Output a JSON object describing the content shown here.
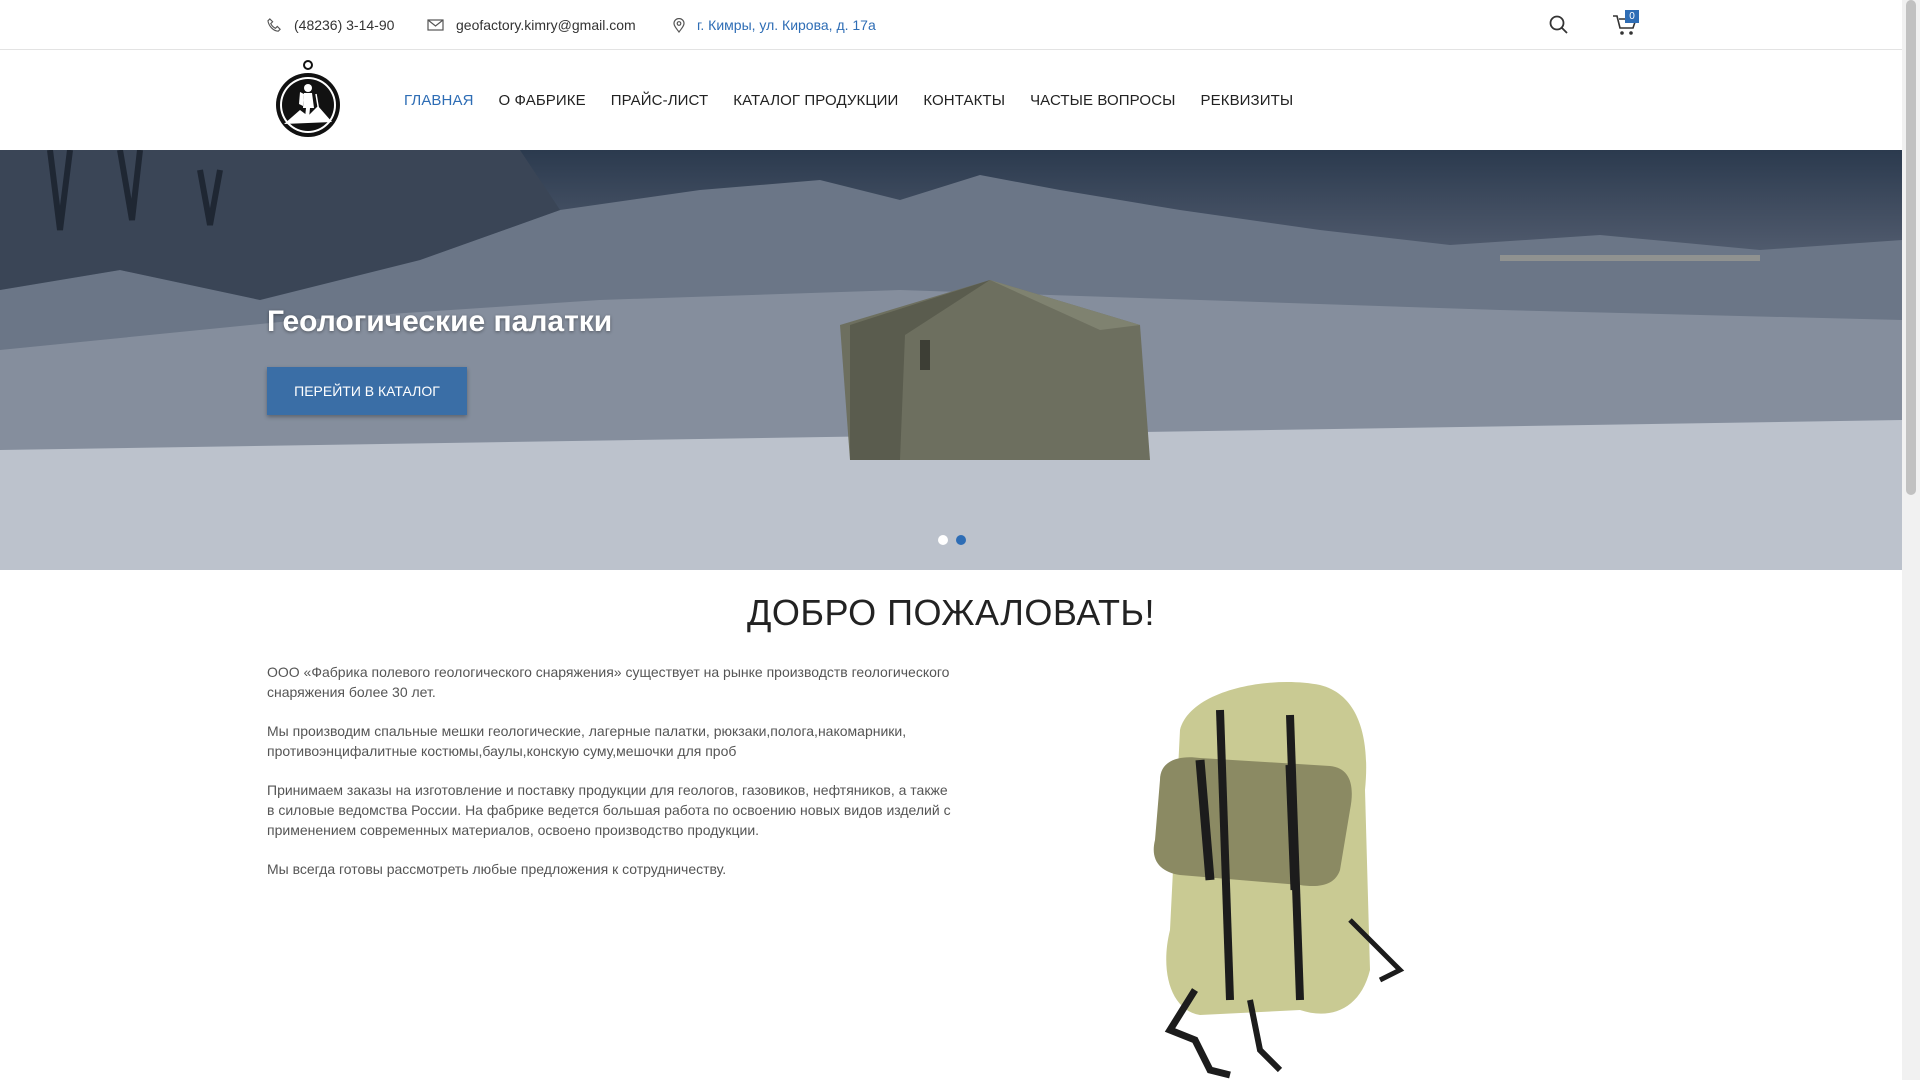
{
  "topbar": {
    "phone": "(48236) 3-14-90",
    "email": "geofactory.kimry@gmail.com",
    "address": "г. Кимры, ул. Кирова, д. 17а",
    "cart_count": "0"
  },
  "nav": {
    "items": [
      {
        "label": "ГЛАВНАЯ"
      },
      {
        "label": "О ФАБРИКЕ"
      },
      {
        "label": "ПРАЙС-ЛИСТ"
      },
      {
        "label": "КАТАЛОГ ПРОДУКЦИИ"
      },
      {
        "label": "КОНТАКТЫ"
      },
      {
        "label": "ЧАСТЫЕ ВОПРОСЫ"
      },
      {
        "label": "РЕКВИЗИТЫ"
      }
    ]
  },
  "hero": {
    "title": "Геологические палатки",
    "button": "ПЕРЕЙТИ В КАТАЛОГ",
    "active_slide": 2
  },
  "content": {
    "heading": "ДОБРО ПОЖАЛОВАТЬ!",
    "paragraphs": [
      "ООО «Фабрика полевого геологического снаряжения» существует на рынке производств геологического снаряжения более 30 лет.",
      "Мы производим спальные мешки геологические, лагерные палатки, рюкзаки,полога,накомарники, противоэнцифалитные костюмы,баулы,конскую суму,мешочки для проб",
      "Принимаем заказы на изготовление и поставку продукции для геологов, газовиков, нефтяников, а также в силовые ведомства России. На фабрике ведется большая работа по освоению новых видов изделий с применением современных материалов, освоено производство продукции.",
      "Мы всегда готовы рассмотреть любые предложения к сотрудничеству."
    ]
  },
  "colors": {
    "accent": "#2e6db5",
    "button": "#3a6ea6"
  },
  "icons": [
    "phone-icon",
    "mail-icon",
    "location-pin-icon",
    "search-icon",
    "cart-icon"
  ]
}
